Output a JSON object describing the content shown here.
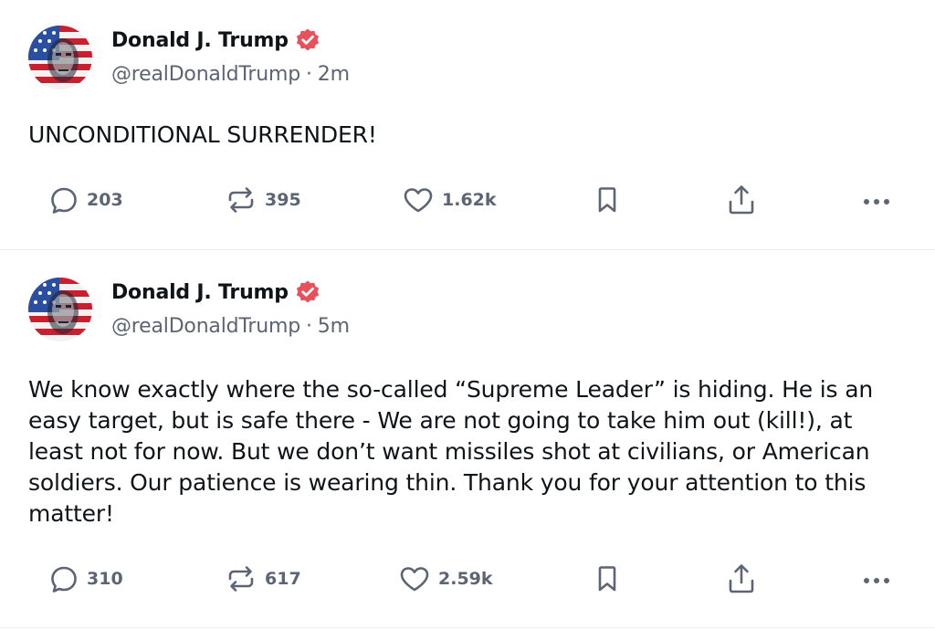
{
  "colors": {
    "verified_badge": "#e8505b",
    "action_gray": "#5b6573",
    "divider": "#eceef0"
  },
  "posts": [
    {
      "author": {
        "display_name": "Donald J. Trump",
        "handle": "@realDonaldTrump",
        "verified_icon": "verified-badge-icon"
      },
      "separator": "·",
      "time": "2m",
      "text": "UNCONDITIONAL SURRENDER!",
      "actions": {
        "replies": "203",
        "reposts": "395",
        "likes": "1.62k"
      }
    },
    {
      "author": {
        "display_name": "Donald J. Trump",
        "handle": "@realDonaldTrump",
        "verified_icon": "verified-badge-icon"
      },
      "separator": "·",
      "time": "5m",
      "text": "We know exactly where the so-called “Supreme Leader” is hiding. He is an easy target, but is safe there - We are not going to take him out (kill!), at least not for now. But we don’t want missiles shot at civilians, or American soldiers. Our patience is wearing thin. Thank you for your attention to this matter!",
      "actions": {
        "replies": "310",
        "reposts": "617",
        "likes": "2.59k"
      }
    }
  ],
  "icons": [
    "reply-icon",
    "repost-icon",
    "like-icon",
    "bookmark-icon",
    "share-icon",
    "more-icon"
  ]
}
